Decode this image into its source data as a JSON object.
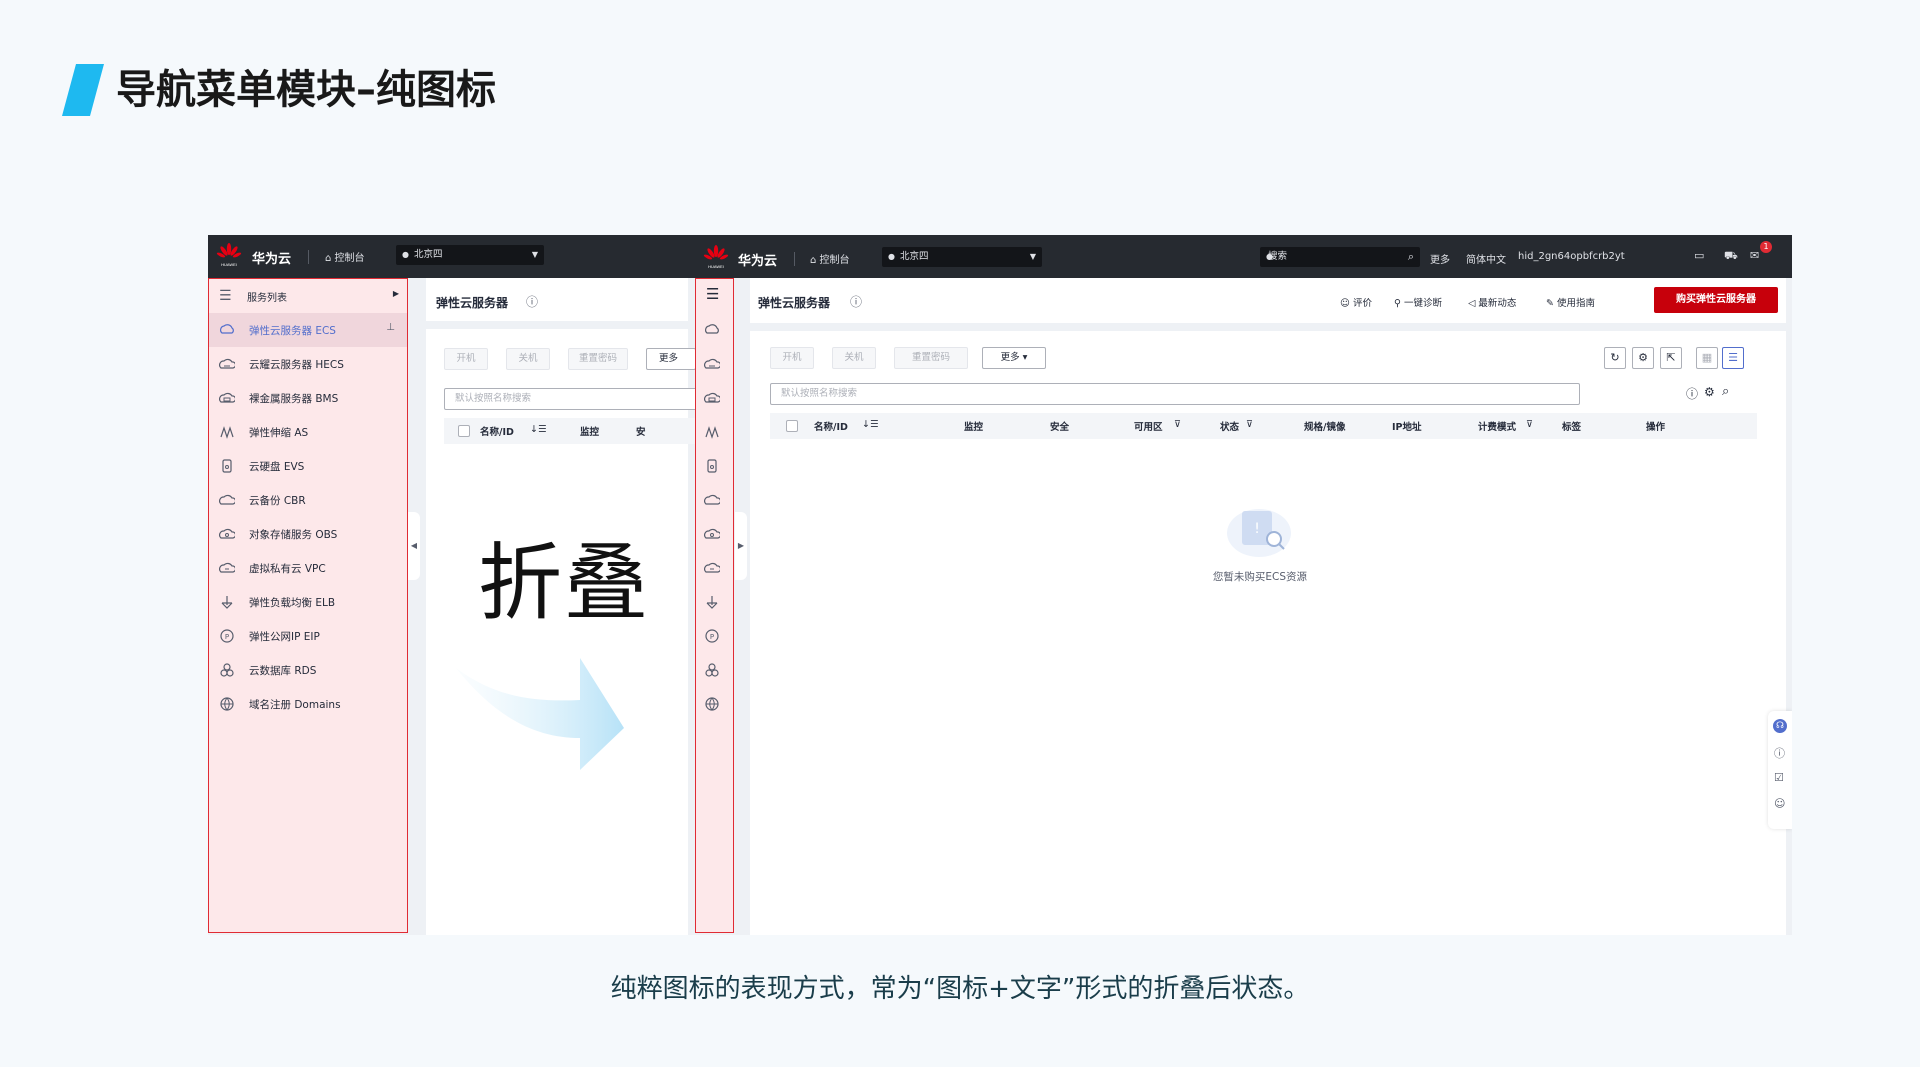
{
  "slide": {
    "title": "导航菜单模块–纯图标",
    "caption": "纯粹图标的表现方式，常为“图标+文字”形式的折叠后状态。",
    "fold_label": "折叠",
    "accent_color": "#1eb9f0"
  },
  "left_shot": {
    "brand": "华为云",
    "logo_text": "HUAWEI",
    "console": "控制台",
    "region": "北京四",
    "menu_header": "服务列表",
    "menu_items": [
      {
        "label": "弹性云服务器 ECS",
        "icon": "ecs-icon",
        "active": true
      },
      {
        "label": "云耀云服务器 HECS",
        "icon": "hecs-icon"
      },
      {
        "label": "裸金属服务器 BMS",
        "icon": "bms-icon"
      },
      {
        "label": "弹性伸缩 AS",
        "icon": "as-icon"
      },
      {
        "label": "云硬盘 EVS",
        "icon": "evs-icon"
      },
      {
        "label": "云备份 CBR",
        "icon": "cbr-icon"
      },
      {
        "label": "对象存储服务 OBS",
        "icon": "obs-icon"
      },
      {
        "label": "虚拟私有云 VPC",
        "icon": "vpc-icon"
      },
      {
        "label": "弹性负载均衡 ELB",
        "icon": "elb-icon"
      },
      {
        "label": "弹性公网IP EIP",
        "icon": "eip-icon"
      },
      {
        "label": "云数据库 RDS",
        "icon": "rds-icon"
      },
      {
        "label": "域名注册 Domains",
        "icon": "domains-icon"
      }
    ],
    "page_title": "弹性云服务器",
    "buttons": [
      "开机",
      "关机",
      "重置密码",
      "更多"
    ],
    "search_placeholder": "默认按照名称搜索",
    "columns": [
      "名称/ID",
      "监控",
      "安"
    ]
  },
  "right_shot": {
    "brand": "华为云",
    "logo_text": "HUAWEI",
    "console": "控制台",
    "region": "北京四",
    "search_placeholder": "搜索",
    "more": "更多",
    "language": "简体中文",
    "username": "hid_2gn64opbfcrb2yt",
    "notification_count": "1",
    "page_title": "弹性云服务器",
    "header_links": [
      "评价",
      "一键诊断",
      "最新动态",
      "使用指南"
    ],
    "buy_button": "购买弹性云服务器",
    "buttons": [
      "开机",
      "关机",
      "重置密码",
      "更多"
    ],
    "table_search_placeholder": "默认按照名称搜索",
    "columns": [
      "名称/ID",
      "监控",
      "安全",
      "可用区",
      "状态",
      "规格/镜像",
      "IP地址",
      "计费模式",
      "标签",
      "操作"
    ],
    "empty_text": "您暂未购买ECS资源",
    "collapsed_icons": [
      "ecs-icon",
      "hecs-icon",
      "bms-icon",
      "as-icon",
      "evs-icon",
      "cbr-icon",
      "obs-icon",
      "vpc-icon",
      "elb-icon",
      "eip-icon",
      "rds-icon",
      "domains-icon"
    ]
  }
}
